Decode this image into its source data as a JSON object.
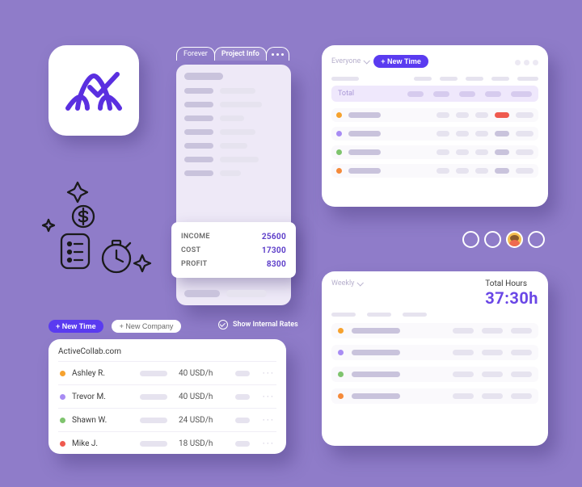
{
  "project_info": {
    "tabs": {
      "forever": "Forever",
      "info": "Project Info"
    },
    "summary": {
      "income_label": "INCOME",
      "income_value": "25600",
      "cost_label": "COST",
      "cost_value": "17300",
      "profit_label": "PROFIT",
      "profit_value": "8300"
    }
  },
  "tracking": {
    "filter_label": "Everyone",
    "new_time_label": "+ New Time",
    "total_label": "Total",
    "rows": [
      {
        "dot": "#f6a22e",
        "accent": "#ef5a4f"
      },
      {
        "dot": "#a88cf3",
        "accent": "#c9c3dc"
      },
      {
        "dot": "#7fc46e",
        "accent": "#c9c3dc"
      },
      {
        "dot": "#f58a3a",
        "accent": "#c9c3dc"
      }
    ]
  },
  "hours": {
    "filter_label": "Weekly",
    "total_label": "Total Hours",
    "total_value": "37:30h",
    "rows": [
      {
        "dot": "#f6a22e"
      },
      {
        "dot": "#a88cf3"
      },
      {
        "dot": "#7fc46e"
      },
      {
        "dot": "#f58a3a"
      }
    ]
  },
  "rates": {
    "new_time_label": "+ New Time",
    "new_company_label": "+ New Company",
    "show_internal_label": "Show Internal Rates",
    "company": "ActiveCollab.com",
    "rows": [
      {
        "dot": "#f6a22e",
        "name": "Ashley R.",
        "rate": "40 USD/h"
      },
      {
        "dot": "#a88cf3",
        "name": "Trevor M.",
        "rate": "40 USD/h"
      },
      {
        "dot": "#7fc46e",
        "name": "Shawn W.",
        "rate": "24 USD/h"
      },
      {
        "dot": "#ef5a4f",
        "name": "Mike J.",
        "rate": "18 USD/h"
      }
    ]
  }
}
